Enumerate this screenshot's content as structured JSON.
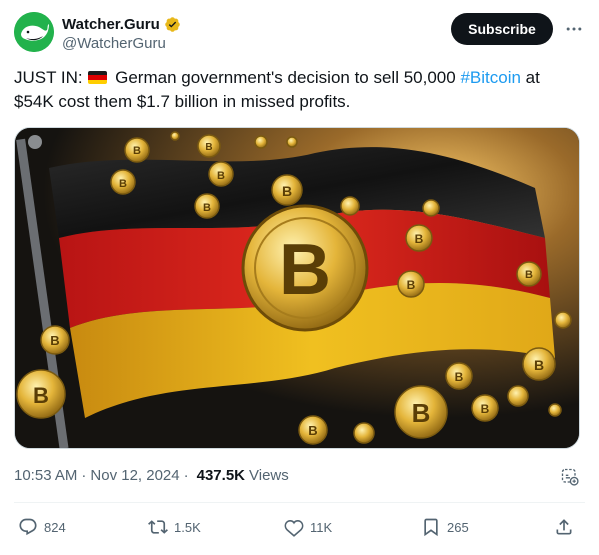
{
  "author": {
    "display_name": "Watcher.Guru",
    "handle": "@WatcherGuru",
    "verified_color": "#e8b81a",
    "avatar_icon": "whale-logo-icon",
    "avatar_color": "#22b24c"
  },
  "subscribe_label": "Subscribe",
  "more_icon": "more-horizontal-icon",
  "post": {
    "prefix": "JUST IN:",
    "flag": "germany-flag-emoji",
    "text_before_tag": "German government's decision to sell 50,000",
    "hashtag": "#Bitcoin",
    "text_after_tag": "at $54K cost them $1.7 billion in missed profits.",
    "link_color": "#1d9bf0"
  },
  "media": {
    "alt": "German flag with Bitcoin coins",
    "flag_colors": [
      "#1c1c1c",
      "#d62020",
      "#e8b31a"
    ]
  },
  "meta": {
    "time": "10:53 AM",
    "date": "Nov 12, 2024",
    "views_count": "437.5K",
    "views_label": "Views"
  },
  "actions": {
    "replies": "824",
    "reposts": "1.5K",
    "likes": "11K",
    "bookmarks": "265"
  }
}
